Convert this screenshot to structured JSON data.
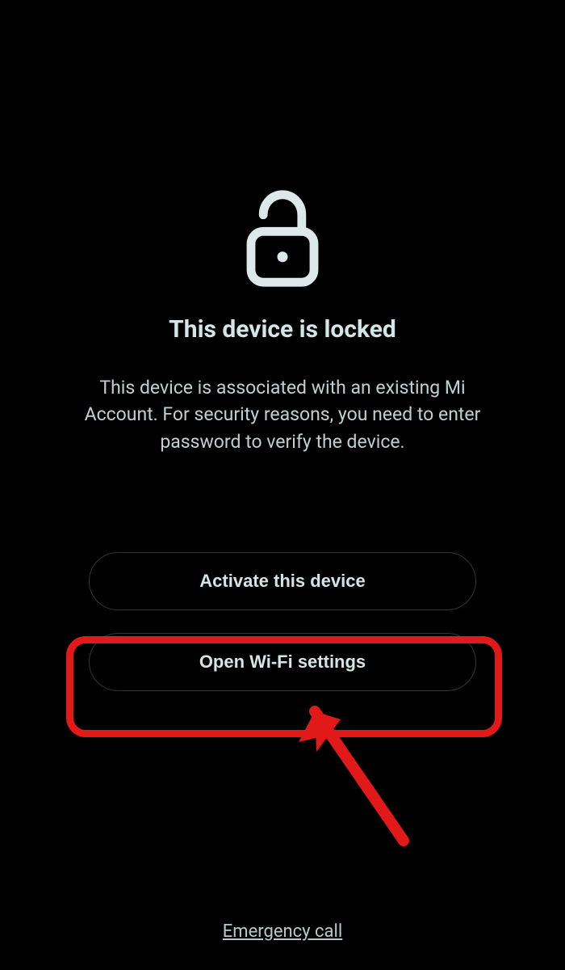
{
  "lock": {
    "icon_name": "unlock-icon"
  },
  "title": "This device is locked",
  "description": "This device is associated with an existing Mi Account. For security reasons, you need to enter password to verify the device.",
  "buttons": {
    "activate": "Activate this device",
    "wifi": "Open Wi-Fi settings"
  },
  "emergency_link": "Emergency call",
  "annotation": {
    "highlight_target": "open-wifi-settings-button"
  }
}
